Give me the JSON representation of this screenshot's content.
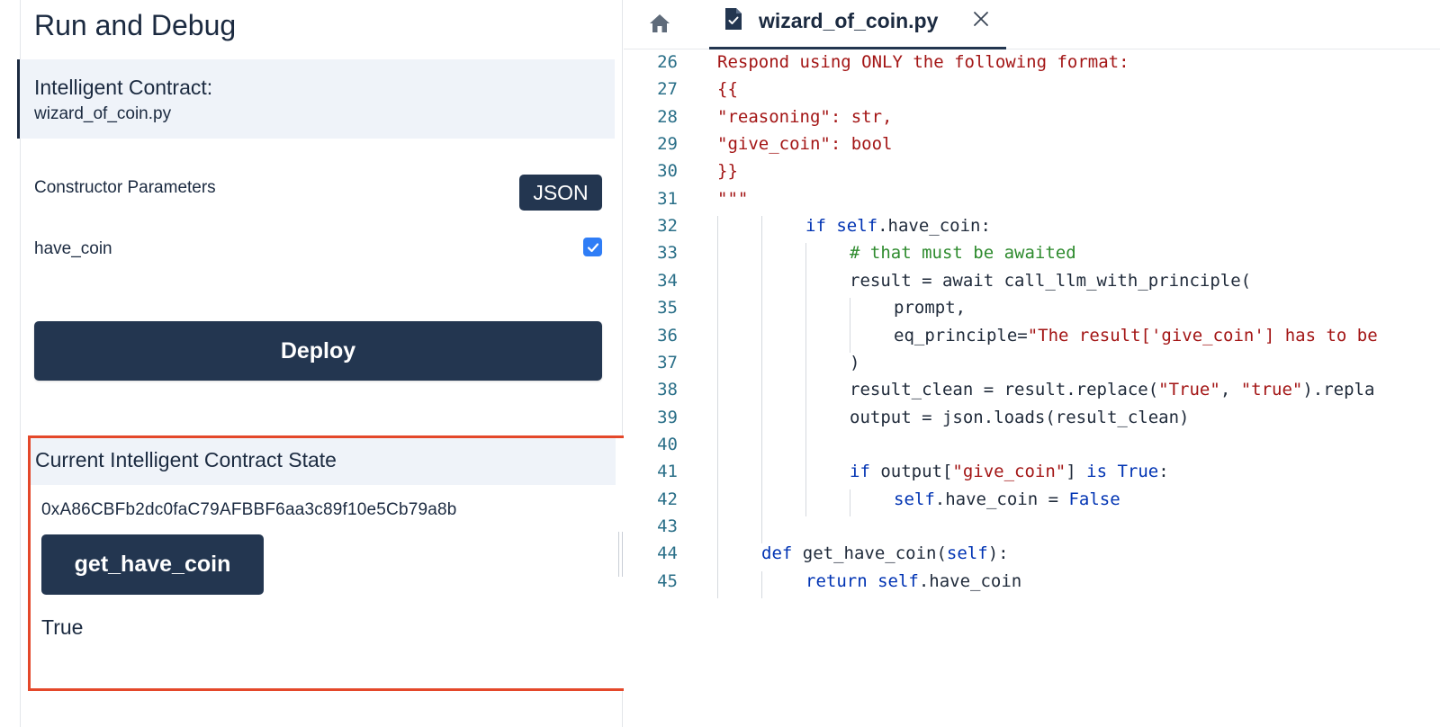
{
  "sidebar": {
    "title": "Run and Debug",
    "contract_label": "Intelligent Contract:",
    "contract_file": "wizard_of_coin.py",
    "constructor_label": "Constructor Parameters",
    "json_button": "JSON",
    "param_name": "have_coin",
    "param_checked": true,
    "deploy_button": "Deploy"
  },
  "state": {
    "title": "Current Intelligent Contract State",
    "address": "0xA86CBFb2dc0faC79AFBBF6aa3c89f10e5Cb79a8b",
    "method_button": "get_have_coin",
    "result": "True"
  },
  "editor": {
    "tab_label": "wizard_of_coin.py",
    "lines": [
      {
        "n": "26",
        "indent": 0,
        "tokens": [
          {
            "t": "Respond using ONLY the following format:",
            "c": "str"
          }
        ]
      },
      {
        "n": "27",
        "indent": 0,
        "tokens": [
          {
            "t": "{{",
            "c": "str"
          }
        ]
      },
      {
        "n": "28",
        "indent": 0,
        "tokens": [
          {
            "t": "\"reasoning\": str,",
            "c": "str"
          }
        ]
      },
      {
        "n": "29",
        "indent": 0,
        "tokens": [
          {
            "t": "\"give_coin\": bool",
            "c": "str"
          }
        ]
      },
      {
        "n": "30",
        "indent": 0,
        "tokens": [
          {
            "t": "}}",
            "c": "str"
          }
        ]
      },
      {
        "n": "31",
        "indent": 0,
        "tokens": [
          {
            "t": "\"\"\"",
            "c": "str"
          }
        ]
      },
      {
        "n": "32",
        "indent": 2,
        "tokens": [
          {
            "t": "if",
            "c": "kw"
          },
          {
            "t": " self",
            "c": "kw"
          },
          {
            "t": ".have_coin:",
            "c": "plain"
          }
        ]
      },
      {
        "n": "33",
        "indent": 3,
        "tokens": [
          {
            "t": "# that must be awaited",
            "c": "com"
          }
        ]
      },
      {
        "n": "34",
        "indent": 3,
        "tokens": [
          {
            "t": "result = await call_llm_with_principle(",
            "c": "plain"
          }
        ]
      },
      {
        "n": "35",
        "indent": 4,
        "tokens": [
          {
            "t": "prompt,",
            "c": "plain"
          }
        ]
      },
      {
        "n": "36",
        "indent": 4,
        "tokens": [
          {
            "t": "eq_principle=",
            "c": "plain"
          },
          {
            "t": "\"The result['give_coin'] has to be",
            "c": "str"
          }
        ]
      },
      {
        "n": "37",
        "indent": 3,
        "tokens": [
          {
            "t": ")",
            "c": "plain"
          }
        ]
      },
      {
        "n": "38",
        "indent": 3,
        "tokens": [
          {
            "t": "result_clean = result.replace(",
            "c": "plain"
          },
          {
            "t": "\"True\"",
            "c": "str"
          },
          {
            "t": ", ",
            "c": "plain"
          },
          {
            "t": "\"true\"",
            "c": "str"
          },
          {
            "t": ").repla",
            "c": "plain"
          }
        ]
      },
      {
        "n": "39",
        "indent": 3,
        "tokens": [
          {
            "t": "output = json.loads(result_clean)",
            "c": "plain"
          }
        ]
      },
      {
        "n": "40",
        "indent": 3,
        "tokens": []
      },
      {
        "n": "41",
        "indent": 3,
        "tokens": [
          {
            "t": "if",
            "c": "kw"
          },
          {
            "t": " output[",
            "c": "plain"
          },
          {
            "t": "\"give_coin\"",
            "c": "str"
          },
          {
            "t": "] ",
            "c": "plain"
          },
          {
            "t": "is True",
            "c": "kw"
          },
          {
            "t": ":",
            "c": "plain"
          }
        ]
      },
      {
        "n": "42",
        "indent": 4,
        "tokens": [
          {
            "t": "self",
            "c": "kw"
          },
          {
            "t": ".have_coin = ",
            "c": "plain"
          },
          {
            "t": "False",
            "c": "kw"
          }
        ]
      },
      {
        "n": "43",
        "indent": 2,
        "tokens": []
      },
      {
        "n": "44",
        "indent": 1,
        "tokens": [
          {
            "t": "def",
            "c": "kw"
          },
          {
            "t": " get_have_coin(",
            "c": "plain"
          },
          {
            "t": "self",
            "c": "kw"
          },
          {
            "t": "):",
            "c": "plain"
          }
        ]
      },
      {
        "n": "45",
        "indent": 2,
        "tokens": [
          {
            "t": "return",
            "c": "kw"
          },
          {
            "t": " self",
            "c": "kw"
          },
          {
            "t": ".have_coin",
            "c": "plain"
          }
        ]
      }
    ]
  },
  "colors": {
    "primary_button": "#233650",
    "highlight_border": "#e4482a",
    "checkbox": "#2f7df6",
    "string": "#a31515",
    "keyword": "#0033b3",
    "comment": "#2e8b2e",
    "line_number": "#2a6f88"
  },
  "icons": {
    "home": "home-icon",
    "file": "file-check-icon",
    "close": "close-icon",
    "check": "checkmark-icon"
  }
}
